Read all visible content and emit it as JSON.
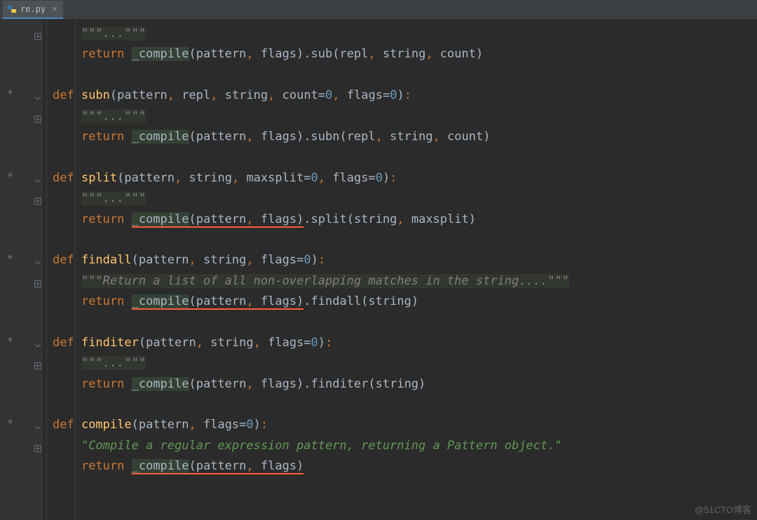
{
  "tab": {
    "filename": "re.py",
    "close": "×"
  },
  "code": {
    "lines": [
      {
        "indent": "    ",
        "pre": "",
        "tokens": [
          {
            "t": "\"\"\"",
            "c": "doc"
          },
          {
            "t": "...",
            "c": "doc"
          },
          {
            "t": "\"\"\"",
            "c": "doc"
          }
        ]
      },
      {
        "indent": "    ",
        "tokens": [
          {
            "t": "return ",
            "c": "kw"
          },
          {
            "t": "_compile",
            "c": "compile-hl"
          },
          {
            "t": "(pattern",
            "c": ""
          },
          {
            "t": ", ",
            "c": "kw"
          },
          {
            "t": "flags).sub(repl",
            "c": ""
          },
          {
            "t": ", ",
            "c": "kw"
          },
          {
            "t": "string",
            "c": ""
          },
          {
            "t": ", ",
            "c": "kw"
          },
          {
            "t": "count)",
            "c": ""
          }
        ]
      },
      {
        "blank": true
      },
      {
        "tokens": [
          {
            "t": "def ",
            "c": "kw"
          },
          {
            "t": "subn",
            "c": "fname"
          },
          {
            "t": "(pattern",
            "c": ""
          },
          {
            "t": ", ",
            "c": "kw"
          },
          {
            "t": "repl",
            "c": ""
          },
          {
            "t": ", ",
            "c": "kw"
          },
          {
            "t": "string",
            "c": ""
          },
          {
            "t": ", ",
            "c": "kw"
          },
          {
            "t": "count=",
            "c": ""
          },
          {
            "t": "0",
            "c": "num"
          },
          {
            "t": ", ",
            "c": "kw"
          },
          {
            "t": "flags=",
            "c": ""
          },
          {
            "t": "0",
            "c": "num"
          },
          {
            "t": ")",
            "c": ""
          },
          {
            "t": ":",
            "c": "kw"
          }
        ],
        "star": true
      },
      {
        "indent": "    ",
        "tokens": [
          {
            "t": "\"\"\"",
            "c": "doc"
          },
          {
            "t": "...",
            "c": "doc"
          },
          {
            "t": "\"\"\"",
            "c": "doc"
          }
        ]
      },
      {
        "indent": "    ",
        "tokens": [
          {
            "t": "return ",
            "c": "kw"
          },
          {
            "t": "_compile",
            "c": "compile-hl"
          },
          {
            "t": "(pattern",
            "c": ""
          },
          {
            "t": ", ",
            "c": "kw"
          },
          {
            "t": "flags).subn(repl",
            "c": ""
          },
          {
            "t": ", ",
            "c": "kw"
          },
          {
            "t": "string",
            "c": ""
          },
          {
            "t": ", ",
            "c": "kw"
          },
          {
            "t": "count)",
            "c": ""
          }
        ]
      },
      {
        "blank": true
      },
      {
        "tokens": [
          {
            "t": "def ",
            "c": "kw"
          },
          {
            "t": "split",
            "c": "fname"
          },
          {
            "t": "(pattern",
            "c": ""
          },
          {
            "t": ", ",
            "c": "kw"
          },
          {
            "t": "string",
            "c": ""
          },
          {
            "t": ", ",
            "c": "kw"
          },
          {
            "t": "maxsplit=",
            "c": ""
          },
          {
            "t": "0",
            "c": "num"
          },
          {
            "t": ", ",
            "c": "kw"
          },
          {
            "t": "flags=",
            "c": ""
          },
          {
            "t": "0",
            "c": "num"
          },
          {
            "t": ")",
            "c": ""
          },
          {
            "t": ":",
            "c": "kw"
          }
        ],
        "star": true
      },
      {
        "indent": "    ",
        "tokens": [
          {
            "t": "\"\"\"",
            "c": "doc"
          },
          {
            "t": "...",
            "c": "doc"
          },
          {
            "t": "\"\"\"",
            "c": "doc"
          }
        ]
      },
      {
        "indent": "    ",
        "tokens": [
          {
            "t": "return ",
            "c": "kw"
          },
          {
            "t": "_compile",
            "c": "compile-hl underline-red",
            "u": true
          },
          {
            "t": "(pattern",
            "c": "underline-red"
          },
          {
            "t": ", ",
            "c": "kw underline-red"
          },
          {
            "t": "flags)",
            "c": "underline-red"
          },
          {
            "t": ".split(string",
            "c": ""
          },
          {
            "t": ", ",
            "c": "kw"
          },
          {
            "t": "maxsplit)",
            "c": ""
          }
        ]
      },
      {
        "blank": true
      },
      {
        "tokens": [
          {
            "t": "def ",
            "c": "kw"
          },
          {
            "t": "findall",
            "c": "fname"
          },
          {
            "t": "(pattern",
            "c": ""
          },
          {
            "t": ", ",
            "c": "kw"
          },
          {
            "t": "string",
            "c": ""
          },
          {
            "t": ", ",
            "c": "kw"
          },
          {
            "t": "flags=",
            "c": ""
          },
          {
            "t": "0",
            "c": "num"
          },
          {
            "t": ")",
            "c": ""
          },
          {
            "t": ":",
            "c": "kw"
          }
        ],
        "star": true
      },
      {
        "indent": "    ",
        "tokens": [
          {
            "t": "\"\"\"Return a list of all non-overlapping matches in the string....\"\"\"",
            "c": "doc"
          }
        ]
      },
      {
        "indent": "    ",
        "tokens": [
          {
            "t": "return ",
            "c": "kw"
          },
          {
            "t": "_compile",
            "c": "compile-hl underline-red"
          },
          {
            "t": "(pattern",
            "c": "underline-red"
          },
          {
            "t": ", ",
            "c": "kw underline-red"
          },
          {
            "t": "flags)",
            "c": "underline-red"
          },
          {
            "t": ".findall(string)",
            "c": ""
          }
        ]
      },
      {
        "blank": true
      },
      {
        "tokens": [
          {
            "t": "def ",
            "c": "kw"
          },
          {
            "t": "finditer",
            "c": "fname"
          },
          {
            "t": "(pattern",
            "c": ""
          },
          {
            "t": ", ",
            "c": "kw"
          },
          {
            "t": "string",
            "c": ""
          },
          {
            "t": ", ",
            "c": "kw"
          },
          {
            "t": "flags=",
            "c": ""
          },
          {
            "t": "0",
            "c": "num"
          },
          {
            "t": ")",
            "c": ""
          },
          {
            "t": ":",
            "c": "kw"
          }
        ],
        "star": true
      },
      {
        "indent": "    ",
        "tokens": [
          {
            "t": "\"\"\"",
            "c": "doc"
          },
          {
            "t": "...",
            "c": "doc"
          },
          {
            "t": "\"\"\"",
            "c": "doc"
          }
        ]
      },
      {
        "indent": "    ",
        "tokens": [
          {
            "t": "return ",
            "c": "kw"
          },
          {
            "t": "_compile",
            "c": "compile-hl"
          },
          {
            "t": "(pattern",
            "c": ""
          },
          {
            "t": ", ",
            "c": "kw"
          },
          {
            "t": "flags).finditer(string)",
            "c": ""
          }
        ]
      },
      {
        "blank": true
      },
      {
        "tokens": [
          {
            "t": "def ",
            "c": "kw"
          },
          {
            "t": "compile",
            "c": "fname"
          },
          {
            "t": "(pattern",
            "c": ""
          },
          {
            "t": ", ",
            "c": "kw"
          },
          {
            "t": "flags=",
            "c": ""
          },
          {
            "t": "0",
            "c": "num"
          },
          {
            "t": ")",
            "c": ""
          },
          {
            "t": ":",
            "c": "kw"
          }
        ],
        "star": true
      },
      {
        "indent": "    ",
        "tokens": [
          {
            "t": "\"Compile a regular expression pattern, returning a Pattern object.\"",
            "c": "doc2"
          }
        ]
      },
      {
        "indent": "    ",
        "tokens": [
          {
            "t": "return ",
            "c": "kw"
          },
          {
            "t": "_compile",
            "c": "compile-hl underline-red"
          },
          {
            "t": "(pattern",
            "c": "underline-red"
          },
          {
            "t": ", ",
            "c": "kw underline-red"
          },
          {
            "t": "flags)",
            "c": "underline-red"
          }
        ]
      }
    ]
  },
  "watermark": "@51CTO博客"
}
